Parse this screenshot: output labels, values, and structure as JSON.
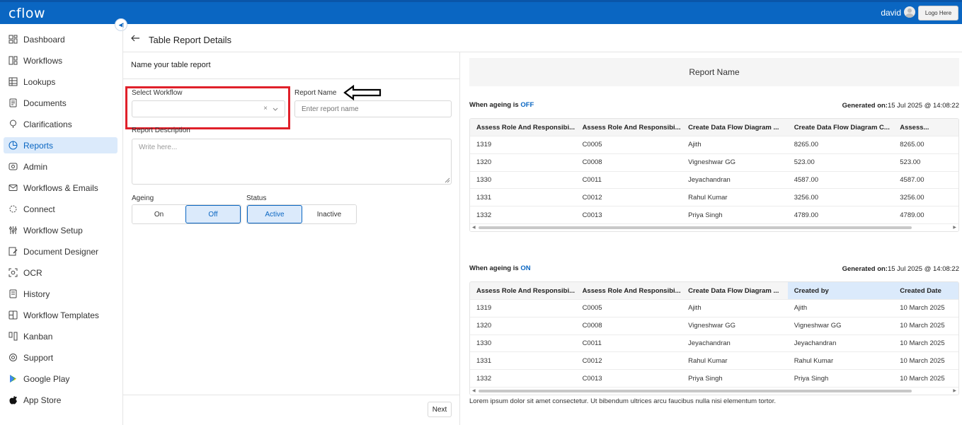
{
  "app": {
    "logo": "cflow",
    "user": "david",
    "logo_button": "Logo Here"
  },
  "sidebar": {
    "items": [
      {
        "label": "Dashboard",
        "icon": "dashboard-icon"
      },
      {
        "label": "Workflows",
        "icon": "workflows-icon"
      },
      {
        "label": "Lookups",
        "icon": "lookups-icon"
      },
      {
        "label": "Documents",
        "icon": "documents-icon"
      },
      {
        "label": "Clarifications",
        "icon": "clarifications-icon"
      },
      {
        "label": "Reports",
        "icon": "reports-icon",
        "active": true
      },
      {
        "label": "Admin",
        "icon": "admin-icon"
      },
      {
        "label": "Workflows & Emails",
        "icon": "email-icon"
      },
      {
        "label": "Connect",
        "icon": "connect-icon"
      },
      {
        "label": "Workflow Setup",
        "icon": "setup-icon"
      },
      {
        "label": "Document Designer",
        "icon": "designer-icon"
      },
      {
        "label": "OCR",
        "icon": "ocr-icon"
      },
      {
        "label": "History",
        "icon": "history-icon"
      },
      {
        "label": "Workflow Templates",
        "icon": "templates-icon"
      },
      {
        "label": "Kanban",
        "icon": "kanban-icon"
      },
      {
        "label": "Support",
        "icon": "support-icon"
      },
      {
        "label": "Google Play",
        "icon": "google-play-icon"
      },
      {
        "label": "App Store",
        "icon": "apple-icon"
      }
    ]
  },
  "page": {
    "title": "Table Report Details"
  },
  "form": {
    "section_title": "Name your table report",
    "workflow_label": "Select Workflow",
    "workflow_value": "",
    "clear_glyph": "×",
    "report_name_label": "Report Name",
    "report_name_placeholder": "Enter report name",
    "description_label": "Report Description",
    "description_placeholder": "Write here...",
    "ageing_label": "Ageing",
    "ageing_options": [
      "On",
      "Off"
    ],
    "ageing_selected": "Off",
    "status_label": "Status",
    "status_options": [
      "Active",
      "Inactive"
    ],
    "status_selected": "Active",
    "next_label": "Next"
  },
  "preview": {
    "report_name": "Report Name",
    "off": {
      "prefix": "When ageing is ",
      "value": "OFF",
      "generated_label": "Generated on:",
      "generated_value": "15 Jul 2025 @ 14:08:22",
      "columns": [
        "Assess Role And Responsibi...",
        "Assess Role And Responsibi...",
        "Create Data Flow Diagram ...",
        "Create Data Flow Diagram C...",
        "Assess..."
      ],
      "rows": [
        [
          "1319",
          "C0005",
          "Ajith",
          "8265.00",
          "8265.00"
        ],
        [
          "1320",
          "C0008",
          "Vigneshwar GG",
          "523.00",
          "523.00"
        ],
        [
          "1330",
          "C0011",
          "Jeyachandran",
          "4587.00",
          "4587.00"
        ],
        [
          "1331",
          "C0012",
          "Rahul Kumar",
          "3256.00",
          "3256.00"
        ],
        [
          "1332",
          "C0013",
          "Priya Singh",
          "4789.00",
          "4789.00"
        ]
      ]
    },
    "on": {
      "prefix": "When ageing is ",
      "value": "ON",
      "generated_label": "Generated on:",
      "generated_value": "15 Jul 2025 @ 14:08:22",
      "columns": [
        "Assess Role And Responsibi...",
        "Assess Role And Responsibi...",
        "Create Data Flow Diagram ...",
        "Created by",
        "Created Date"
      ],
      "rows": [
        [
          "1319",
          "C0005",
          "Ajith",
          "Ajith",
          "10 March 2025"
        ],
        [
          "1320",
          "C0008",
          "Vigneshwar GG",
          "Vigneshwar GG",
          "10 March 2025"
        ],
        [
          "1330",
          "C0011",
          "Jeyachandran",
          "Jeyachandran",
          "10 March 2025"
        ],
        [
          "1331",
          "C0012",
          "Rahul Kumar",
          "Rahul Kumar",
          "10 March 2025"
        ],
        [
          "1332",
          "C0013",
          "Priya Singh",
          "Priya Singh",
          "10 March 2025"
        ]
      ]
    },
    "footnote": "Lorem ipsum dolor sit amet consectetur. Ut bibendum ultrices arcu faucibus nulla nisi elementum tortor."
  },
  "colors": {
    "brand": "#0a66c2",
    "active_bg": "#dbeafb",
    "annotation_red": "#e0202a"
  }
}
